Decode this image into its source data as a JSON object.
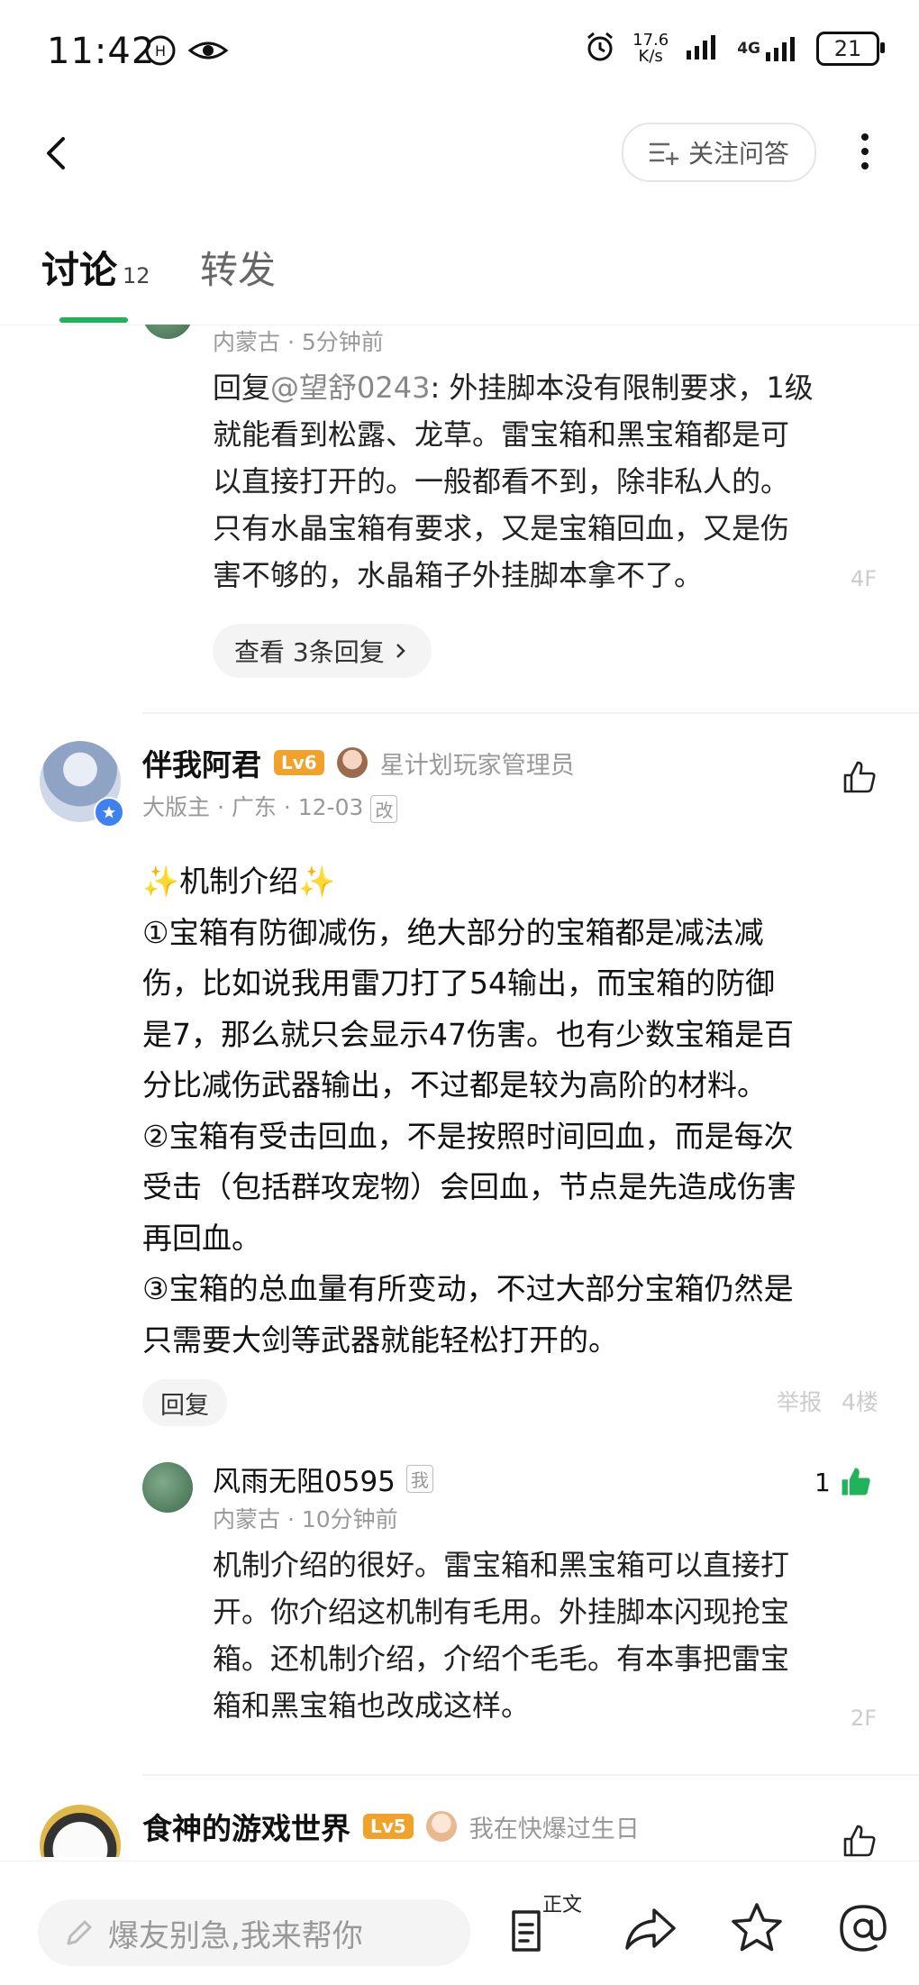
{
  "status": {
    "time": "11:42",
    "net_speed_top": "17.6",
    "net_speed_bottom": "K/s",
    "network": "4G",
    "battery": "21"
  },
  "topbar": {
    "follow_label": "关注问答"
  },
  "tabs": {
    "discuss_label": "讨论",
    "discuss_count": "12",
    "forward_label": "转发"
  },
  "reply_top": {
    "location": "内蒙古",
    "time": "5分钟前",
    "prefix": "回复",
    "mention": "@望舒0243",
    "lines": [
      ": 外挂脚本没有限制要求，1级",
      "就能看到松露、龙草。雷宝箱和黑宝箱都是可",
      "以直接打开的。一般都看不到，除非私人的。",
      "只有水晶宝箱有要求，又是宝箱回血，又是伤",
      "害不够的，水晶箱子外挂脚本拿不了。"
    ],
    "floor": "4F",
    "view_replies": "查看 3条回复"
  },
  "post": {
    "username": "伴我阿君",
    "level": "Lv6",
    "title": "星计划玩家管理员",
    "role": "大版主",
    "location": "广东",
    "date": "12-03",
    "edited_tag": "改",
    "paragraphs": [
      "✨机制介绍✨",
      "①宝箱有防御减伤，绝大部分的宝箱都是减法减",
      "伤，比如说我用雷刀打了54输出，而宝箱的防御",
      "是7，那么就只会显示47伤害。也有少数宝箱是百",
      "分比减伤武器输出，不过都是较为高阶的材料。",
      "②宝箱有受击回血，不是按照时间回血，而是每次",
      "受击（包括群攻宠物）会回血，节点是先造成伤害",
      "再回血。",
      "③宝箱的总血量有所变动，不过大部分宝箱仍然是",
      "只需要大剑等武器就能轻松打开的。"
    ],
    "reply_label": "回复",
    "report_label": "举报",
    "floor": "4楼"
  },
  "sub_reply": {
    "username": "风雨无阻0595",
    "self_tag": "我",
    "location": "内蒙古",
    "time": "10分钟前",
    "like_count": "1",
    "lines": [
      "机制介绍的很好。雷宝箱和黑宝箱可以直接打",
      "开。你介绍这机制有毛用。外挂脚本闪现抢宝",
      "箱。还机制介绍，介绍个毛毛。有本事把雷宝",
      "箱和黑宝箱也改成这样。"
    ],
    "floor": "2F"
  },
  "next_post": {
    "username": "食神的游戏世界",
    "level": "Lv5",
    "title": "我在快爆过生日"
  },
  "bottombar": {
    "input_placeholder": "爆友别急,我来帮你",
    "main_text_label": "正文"
  },
  "colors": {
    "accent_green": "#21b25c",
    "level_badge": "#f0a22a",
    "muted_text": "#999999"
  }
}
